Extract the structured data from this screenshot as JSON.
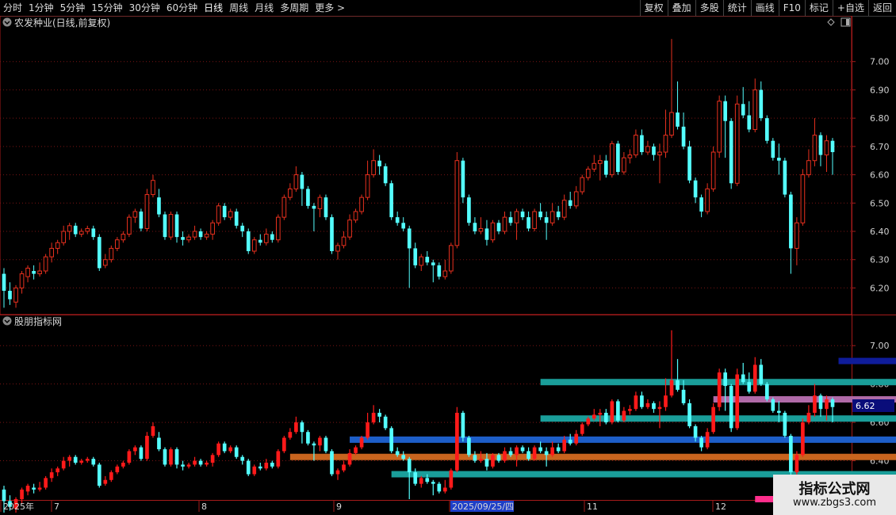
{
  "toolbar": {
    "periods": [
      "分时",
      "1分钟",
      "5分钟",
      "15分钟",
      "30分钟",
      "60分钟",
      "日线",
      "周线",
      "月线",
      "多周期",
      "更多 >"
    ],
    "active_period": "日线",
    "actions": [
      "复权",
      "叠加",
      "多股",
      "统计",
      "画线",
      "F10",
      "标记",
      "+自选",
      "返回"
    ]
  },
  "main_panel": {
    "title": "农发种业(日线,前复权)",
    "collapse_icon": "chevron-down-icon",
    "diamond_icon": "diamond-icon",
    "layout_icon": "panel-toggle-icon",
    "price_ticks": [
      "7.00",
      "6.90",
      "6.80",
      "6.70",
      "6.60",
      "6.50",
      "6.40",
      "6.30",
      "6.20"
    ]
  },
  "indicator_panel": {
    "title": "股朋指标网",
    "collapse_icon": "chevron-down-icon",
    "price_ticks": [
      "7.00",
      "6.80",
      "6.60",
      "6.40"
    ],
    "current_price": "6.62"
  },
  "date_axis": {
    "labels": [
      "2025年",
      "7",
      "8",
      "9",
      "2025/09/25/四",
      "11",
      "12"
    ]
  },
  "watermark": {
    "title": "指标公式网",
    "url": "www.zbgs3.com"
  },
  "colors": {
    "up": "#e8301e",
    "down": "#54ffff",
    "axis": "#a51a1a",
    "text": "#d8d8d8",
    "highlight_date": "#1e3fc8",
    "current_price_box": "#0a0d7a"
  },
  "chart_data": [
    {
      "type": "candlestick",
      "title": "农发种业(日线,前复权)",
      "y_ticks": [
        6.2,
        6.3,
        6.4,
        6.5,
        6.6,
        6.7,
        6.8,
        6.9,
        7.0
      ],
      "ylim": [
        6.12,
        7.1
      ],
      "x_labels": [
        "2025年",
        "7",
        "8",
        "9",
        "2025/09/25/四",
        "11",
        "12"
      ],
      "candles": [
        [
          6.25,
          6.19,
          6.27,
          6.13
        ],
        [
          6.19,
          6.16,
          6.22,
          6.14
        ],
        [
          6.15,
          6.2,
          6.21,
          6.13
        ],
        [
          6.2,
          6.25,
          6.26,
          6.18
        ],
        [
          6.24,
          6.27,
          6.28,
          6.22
        ],
        [
          6.26,
          6.25,
          6.28,
          6.23
        ],
        [
          6.25,
          6.26,
          6.29,
          6.24
        ],
        [
          6.26,
          6.31,
          6.32,
          6.25
        ],
        [
          6.31,
          6.34,
          6.36,
          6.29
        ],
        [
          6.34,
          6.36,
          6.37,
          6.32
        ],
        [
          6.36,
          6.4,
          6.42,
          6.35
        ],
        [
          6.4,
          6.42,
          6.43,
          6.37
        ],
        [
          6.42,
          6.39,
          6.43,
          6.38
        ],
        [
          6.39,
          6.4,
          6.41,
          6.38
        ],
        [
          6.4,
          6.41,
          6.42,
          6.39
        ],
        [
          6.41,
          6.38,
          6.42,
          6.37
        ],
        [
          6.38,
          6.27,
          6.39,
          6.26
        ],
        [
          6.28,
          6.3,
          6.32,
          6.27
        ],
        [
          6.3,
          6.34,
          6.35,
          6.29
        ],
        [
          6.34,
          6.37,
          6.38,
          6.33
        ],
        [
          6.37,
          6.39,
          6.4,
          6.36
        ],
        [
          6.39,
          6.45,
          6.46,
          6.38
        ],
        [
          6.45,
          6.47,
          6.48,
          6.43
        ],
        [
          6.47,
          6.41,
          6.48,
          6.4
        ],
        [
          6.41,
          6.53,
          6.55,
          6.4
        ],
        [
          6.53,
          6.58,
          6.6,
          6.52
        ],
        [
          6.52,
          6.46,
          6.55,
          6.45
        ],
        [
          6.46,
          6.38,
          6.47,
          6.37
        ],
        [
          6.38,
          6.46,
          6.47,
          6.37
        ],
        [
          6.46,
          6.38,
          6.47,
          6.36
        ],
        [
          6.38,
          6.37,
          6.4,
          6.35
        ],
        [
          6.37,
          6.38,
          6.39,
          6.36
        ],
        [
          6.38,
          6.4,
          6.42,
          6.37
        ],
        [
          6.4,
          6.38,
          6.41,
          6.37
        ],
        [
          6.38,
          6.39,
          6.4,
          6.37
        ],
        [
          6.39,
          6.43,
          6.44,
          6.37
        ],
        [
          6.43,
          6.49,
          6.5,
          6.42
        ],
        [
          6.49,
          6.45,
          6.5,
          6.44
        ],
        [
          6.45,
          6.47,
          6.48,
          6.44
        ],
        [
          6.47,
          6.42,
          6.48,
          6.41
        ],
        [
          6.42,
          6.4,
          6.43,
          6.38
        ],
        [
          6.4,
          6.33,
          6.41,
          6.32
        ],
        [
          6.33,
          6.37,
          6.38,
          6.32
        ],
        [
          6.37,
          6.36,
          6.39,
          6.35
        ],
        [
          6.36,
          6.39,
          6.41,
          6.35
        ],
        [
          6.39,
          6.37,
          6.4,
          6.36
        ],
        [
          6.37,
          6.45,
          6.46,
          6.36
        ],
        [
          6.45,
          6.52,
          6.53,
          6.44
        ],
        [
          6.52,
          6.55,
          6.57,
          6.51
        ],
        [
          6.55,
          6.6,
          6.63,
          6.54
        ],
        [
          6.6,
          6.55,
          6.61,
          6.49
        ],
        [
          6.55,
          6.49,
          6.56,
          6.48
        ],
        [
          6.49,
          6.48,
          6.5,
          6.4
        ],
        [
          6.48,
          6.52,
          6.53,
          6.45
        ],
        [
          6.52,
          6.45,
          6.53,
          6.44
        ],
        [
          6.45,
          6.33,
          6.46,
          6.32
        ],
        [
          6.33,
          6.35,
          6.36,
          6.3
        ],
        [
          6.35,
          6.38,
          6.4,
          6.34
        ],
        [
          6.38,
          6.44,
          6.46,
          6.37
        ],
        [
          6.44,
          6.47,
          6.48,
          6.43
        ],
        [
          6.47,
          6.52,
          6.53,
          6.46
        ],
        [
          6.52,
          6.6,
          6.65,
          6.51
        ],
        [
          6.6,
          6.65,
          6.69,
          6.59
        ],
        [
          6.65,
          6.63,
          6.67,
          6.6
        ],
        [
          6.63,
          6.57,
          6.64,
          6.56
        ],
        [
          6.57,
          6.45,
          6.58,
          6.44
        ],
        [
          6.45,
          6.43,
          6.47,
          6.42
        ],
        [
          6.43,
          6.41,
          6.45,
          6.4
        ],
        [
          6.41,
          6.34,
          6.42,
          6.2
        ],
        [
          6.34,
          6.28,
          6.36,
          6.27
        ],
        [
          6.28,
          6.31,
          6.32,
          6.26
        ],
        [
          6.31,
          6.29,
          6.33,
          6.28
        ],
        [
          6.29,
          6.28,
          6.3,
          6.22
        ],
        [
          6.28,
          6.24,
          6.29,
          6.23
        ],
        [
          6.24,
          6.26,
          6.3,
          6.23
        ],
        [
          6.26,
          6.35,
          6.36,
          6.25
        ],
        [
          6.35,
          6.65,
          6.68,
          6.34
        ],
        [
          6.65,
          6.52,
          6.66,
          6.5
        ],
        [
          6.52,
          6.43,
          6.53,
          6.42
        ],
        [
          6.43,
          6.4,
          6.45,
          6.39
        ],
        [
          6.4,
          6.41,
          6.45,
          6.39
        ],
        [
          6.41,
          6.37,
          6.44,
          6.35
        ],
        [
          6.37,
          6.43,
          6.44,
          6.36
        ],
        [
          6.43,
          6.4,
          6.44,
          6.39
        ],
        [
          6.4,
          6.45,
          6.47,
          6.39
        ],
        [
          6.45,
          6.43,
          6.47,
          6.42
        ],
        [
          6.43,
          6.47,
          6.48,
          6.37
        ],
        [
          6.47,
          6.45,
          6.48,
          6.44
        ],
        [
          6.45,
          6.41,
          6.47,
          6.4
        ],
        [
          6.41,
          6.47,
          6.48,
          6.4
        ],
        [
          6.47,
          6.45,
          6.5,
          6.44
        ],
        [
          6.45,
          6.43,
          6.47,
          6.37
        ],
        [
          6.43,
          6.47,
          6.5,
          6.42
        ],
        [
          6.47,
          6.45,
          6.49,
          6.44
        ],
        [
          6.45,
          6.51,
          6.53,
          6.44
        ],
        [
          6.51,
          6.49,
          6.54,
          6.48
        ],
        [
          6.49,
          6.54,
          6.56,
          6.48
        ],
        [
          6.54,
          6.59,
          6.6,
          6.53
        ],
        [
          6.59,
          6.62,
          6.63,
          6.58
        ],
        [
          6.62,
          6.64,
          6.67,
          6.61
        ],
        [
          6.64,
          6.65,
          6.67,
          6.58
        ],
        [
          6.65,
          6.6,
          6.67,
          6.59
        ],
        [
          6.6,
          6.71,
          6.72,
          6.59
        ],
        [
          6.71,
          6.61,
          6.72,
          6.6
        ],
        [
          6.61,
          6.66,
          6.68,
          6.6
        ],
        [
          6.66,
          6.67,
          6.69,
          6.64
        ],
        [
          6.67,
          6.74,
          6.76,
          6.66
        ],
        [
          6.74,
          6.68,
          6.76,
          6.67
        ],
        [
          6.68,
          6.7,
          6.72,
          6.67
        ],
        [
          6.7,
          6.67,
          6.71,
          6.65
        ],
        [
          6.67,
          6.68,
          6.71,
          6.57
        ],
        [
          6.68,
          6.74,
          6.83,
          6.66
        ],
        [
          6.74,
          6.82,
          7.08,
          6.73
        ],
        [
          6.82,
          6.77,
          6.93,
          6.76
        ],
        [
          6.77,
          6.7,
          6.82,
          6.69
        ],
        [
          6.7,
          6.58,
          6.72,
          6.57
        ],
        [
          6.58,
          6.52,
          6.59,
          6.5
        ],
        [
          6.52,
          6.47,
          6.53,
          6.45
        ],
        [
          6.47,
          6.55,
          6.57,
          6.46
        ],
        [
          6.55,
          6.68,
          6.7,
          6.54
        ],
        [
          6.68,
          6.86,
          6.88,
          6.66
        ],
        [
          6.86,
          6.79,
          6.88,
          6.66
        ],
        [
          6.79,
          6.57,
          6.8,
          6.55
        ],
        [
          6.57,
          6.85,
          6.88,
          6.56
        ],
        [
          6.85,
          6.81,
          6.91,
          6.8
        ],
        [
          6.81,
          6.76,
          6.86,
          6.75
        ],
        [
          6.76,
          6.9,
          6.94,
          6.75
        ],
        [
          6.9,
          6.8,
          6.93,
          6.79
        ],
        [
          6.8,
          6.72,
          6.81,
          6.71
        ],
        [
          6.72,
          6.66,
          6.73,
          6.65
        ],
        [
          6.66,
          6.65,
          6.71,
          6.6
        ],
        [
          6.65,
          6.53,
          6.66,
          6.52
        ],
        [
          6.53,
          6.34,
          6.54,
          6.25
        ],
        [
          6.34,
          6.43,
          6.45,
          6.28
        ],
        [
          6.43,
          6.6,
          6.62,
          6.42
        ],
        [
          6.6,
          6.65,
          6.69,
          6.59
        ],
        [
          6.65,
          6.74,
          6.8,
          6.63
        ],
        [
          6.74,
          6.67,
          6.75,
          6.63
        ],
        [
          6.67,
          6.72,
          6.74,
          6.61
        ],
        [
          6.72,
          6.68,
          6.73,
          6.6
        ]
      ]
    },
    {
      "type": "candlestick_with_levels",
      "title": "股朋指标网",
      "y_ticks": [
        6.4,
        6.6,
        6.8,
        7.0
      ],
      "ylim": [
        6.2,
        7.1
      ],
      "current_price": 6.62,
      "levels": [
        {
          "price": 6.92,
          "color": "#0f1c9a",
          "from_index": 140,
          "to_index": 158
        },
        {
          "price": 6.81,
          "color": "#1a9e9a",
          "from_index": 90,
          "to_index": 158
        },
        {
          "price": 6.72,
          "color": "#b06aa8",
          "from_index": 119,
          "to_index": 158
        },
        {
          "price": 6.62,
          "color": "#1a9e9a",
          "from_index": 90,
          "to_index": 158
        },
        {
          "price": 6.51,
          "color": "#1d5ec8",
          "from_index": 58,
          "to_index": 158
        },
        {
          "price": 6.42,
          "color": "#c8641e",
          "from_index": 48,
          "to_index": 158
        },
        {
          "price": 6.33,
          "color": "#1a9e9a",
          "from_index": 65,
          "to_index": 158
        },
        {
          "price": 6.2,
          "color": "#ff2e8c",
          "from_index": 126,
          "to_index": 140
        }
      ]
    }
  ]
}
